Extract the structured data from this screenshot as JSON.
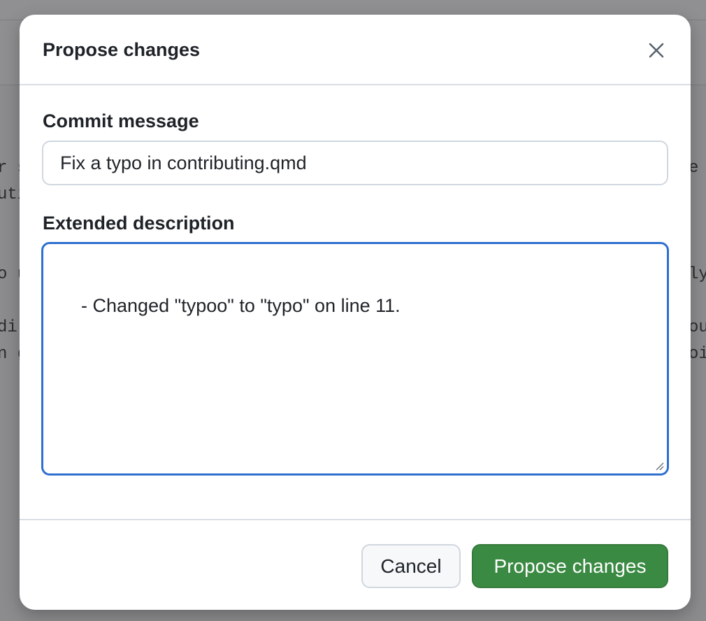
{
  "background": {
    "code_fragments_left": [
      "r s",
      "uti",
      "",
      "",
      "o u",
      "",
      "di",
      "n g"
    ],
    "code_fragments_right": [
      "e",
      "",
      "",
      "",
      "ly",
      "",
      "ou",
      "oi"
    ]
  },
  "modal": {
    "title": "Propose changes",
    "close_icon": "close-icon",
    "commit_message": {
      "label": "Commit message",
      "value": "Fix a typo in contributing.qmd"
    },
    "extended_description": {
      "label": "Extended description",
      "value": "- Changed \"typoo\" to \"typo\" on line 11."
    },
    "buttons": {
      "cancel_label": "Cancel",
      "propose_label": "Propose changes"
    }
  },
  "colors": {
    "primary_button": "#3b8a43",
    "focus_ring": "#2f6fd0",
    "overlay": "#8c8c8e"
  }
}
